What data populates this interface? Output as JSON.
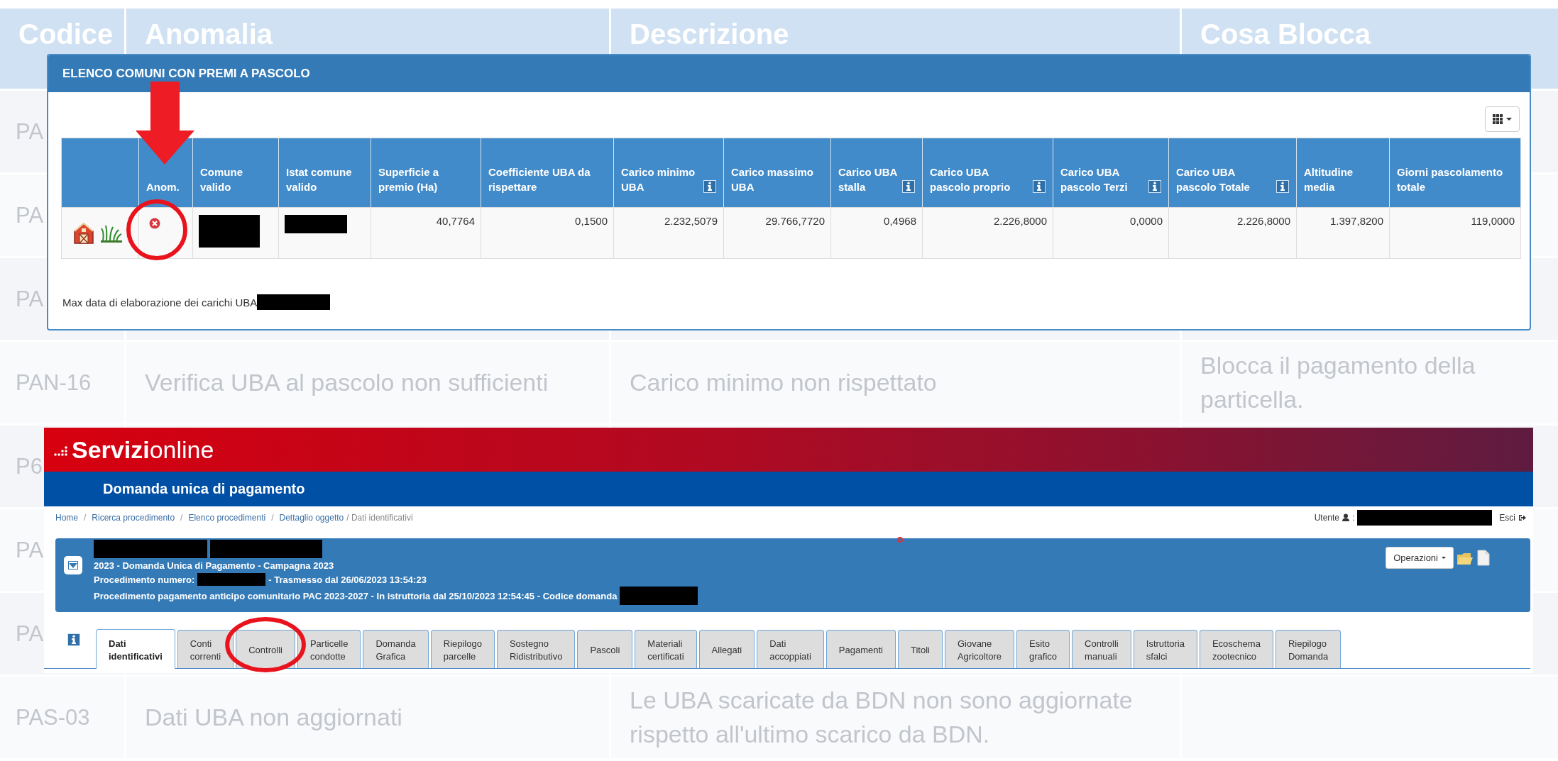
{
  "background_table": {
    "columns": [
      "Codice",
      "Anomalia",
      "Descrizione",
      "Cosa Blocca"
    ],
    "rows": [
      {
        "cells": [
          "PA"
        ]
      },
      {
        "cells": [
          "PA"
        ]
      },
      {
        "cells": [
          "PA"
        ]
      },
      {
        "cells": [
          "PAN-16",
          "Verifica UBA al pascolo non sufficienti",
          "Carico minimo non rispettato",
          "Blocca il pagamento della particella."
        ]
      },
      {
        "cells": [
          "P6"
        ]
      },
      {
        "cells": [
          "PA"
        ]
      },
      {
        "cells": [
          "PA"
        ]
      },
      {
        "cells": [
          "PAS-03",
          "Dati UBA non aggiornati",
          "Le UBA scaricate da BDN non sono aggiornate rispetto all'ultimo scarico da BDN."
        ]
      }
    ]
  },
  "modal": {
    "title": "ELENCO COMUNI CON PREMI A PASCOLO",
    "columns": [
      {
        "kind": "blank"
      },
      {
        "kind": "text",
        "label": "Anom.",
        "info": false
      },
      {
        "kind": "text",
        "label": "Comune valido",
        "info": false
      },
      {
        "kind": "text",
        "label": "Istat comune valido",
        "info": false
      },
      {
        "kind": "text",
        "label": "Superficie a premio (Ha)",
        "info": false
      },
      {
        "kind": "text",
        "label": "Coefficiente UBA da rispettare",
        "info": false
      },
      {
        "kind": "text",
        "label": "Carico minimo UBA",
        "info": true
      },
      {
        "kind": "text",
        "label": "Carico massimo UBA",
        "info": false
      },
      {
        "kind": "text",
        "label": "Carico UBA stalla",
        "info": true
      },
      {
        "kind": "text",
        "label": "Carico UBA pascolo proprio",
        "info": true
      },
      {
        "kind": "text",
        "label": "Carico UBA pascolo Terzi",
        "info": true
      },
      {
        "kind": "text",
        "label": "Carico UBA pascolo Totale",
        "info": true
      },
      {
        "kind": "text",
        "label": "Altitudine media",
        "info": false
      },
      {
        "kind": "text",
        "label": "Giorni pascolamento totale",
        "info": false
      }
    ],
    "rows": [
      {
        "cells": [
          {
            "kind": "icons"
          },
          {
            "kind": "anomaly"
          },
          {
            "kind": "redacted"
          },
          {
            "kind": "redacted"
          },
          {
            "kind": "number",
            "text": "40,7764"
          },
          {
            "kind": "number",
            "text": "0,1500"
          },
          {
            "kind": "number",
            "text": "2.232,5079"
          },
          {
            "kind": "number",
            "text": "29.766,7720"
          },
          {
            "kind": "number",
            "text": "0,4968"
          },
          {
            "kind": "number",
            "text": "2.226,8000"
          },
          {
            "kind": "number",
            "text": "0,0000"
          },
          {
            "kind": "number",
            "text": "2.226,8000"
          },
          {
            "kind": "number",
            "text": "1.397,8200"
          },
          {
            "kind": "number",
            "text": "119,0000"
          }
        ]
      }
    ],
    "footer": "Max data di elaborazione dei carichi UBA"
  },
  "servizi": {
    "brand_bold": "Servizi",
    "brand_light": "online",
    "app_title": "Domanda unica di pagamento",
    "breadcrumb": [
      {
        "kind": "link",
        "text": "Home"
      },
      {
        "kind": "sep",
        "text": "/"
      },
      {
        "kind": "link",
        "text": "Ricerca procedimento"
      },
      {
        "kind": "sep",
        "text": "/"
      },
      {
        "kind": "link",
        "text": "Elenco procedimenti"
      },
      {
        "kind": "sep",
        "text": "/"
      },
      {
        "kind": "link",
        "text": "Dettaglio oggetto"
      },
      {
        "kind": "current",
        "text": "/ Dati identificativi"
      }
    ],
    "user_label": "Utente",
    "user_separator": ":",
    "logout": "Esci",
    "record_lines": [
      [
        {
          "kind": "redacted"
        },
        {
          "kind": "redacted"
        }
      ],
      [
        {
          "kind": "text",
          "text": "2023 - Domanda Unica di Pagamento - Campagna 2023"
        }
      ],
      [
        {
          "kind": "text",
          "text": "Procedimento numero:"
        },
        {
          "kind": "redacted"
        },
        {
          "kind": "text",
          "text": "- Trasmesso dal 26/06/2023 13:54:23"
        }
      ],
      [
        {
          "kind": "text",
          "text": "Procedimento pagamento anticipo comunitario PAC 2023-2027 - In istruttoria dal 25/10/2023 12:54:45 - Codice domanda"
        },
        {
          "kind": "redacted"
        }
      ]
    ],
    "operations_button": "Operazioni",
    "tabs": [
      {
        "label": "Dati\nidentificativi",
        "selected": true
      },
      {
        "label": "Conti\ncorrenti",
        "selected": false
      },
      {
        "label": "Controlli",
        "selected": false
      },
      {
        "label": "Particelle\ncondotte",
        "selected": false
      },
      {
        "label": "Domanda\nGrafica",
        "selected": false
      },
      {
        "label": "Riepilogo\nparcelle",
        "selected": false
      },
      {
        "label": "Sostegno\nRidistributivo",
        "selected": false
      },
      {
        "label": "Pascoli",
        "selected": false
      },
      {
        "label": "Materiali\ncertificati",
        "selected": false
      },
      {
        "label": "Allegati",
        "selected": false
      },
      {
        "label": "Dati\naccoppiati",
        "selected": false
      },
      {
        "label": "Pagamenti",
        "selected": false
      },
      {
        "label": "Titoli",
        "selected": false
      },
      {
        "label": "Giovane\nAgricoltore",
        "selected": false
      },
      {
        "label": "Esito\ngrafico",
        "selected": false
      },
      {
        "label": "Controlli\nmanuali",
        "selected": false
      },
      {
        "label": "Istruttoria\nsfalci",
        "selected": false
      },
      {
        "label": "Ecoschema\nzootecnico",
        "selected": false
      },
      {
        "label": "Riepilogo\nDomanda",
        "selected": false
      }
    ]
  }
}
